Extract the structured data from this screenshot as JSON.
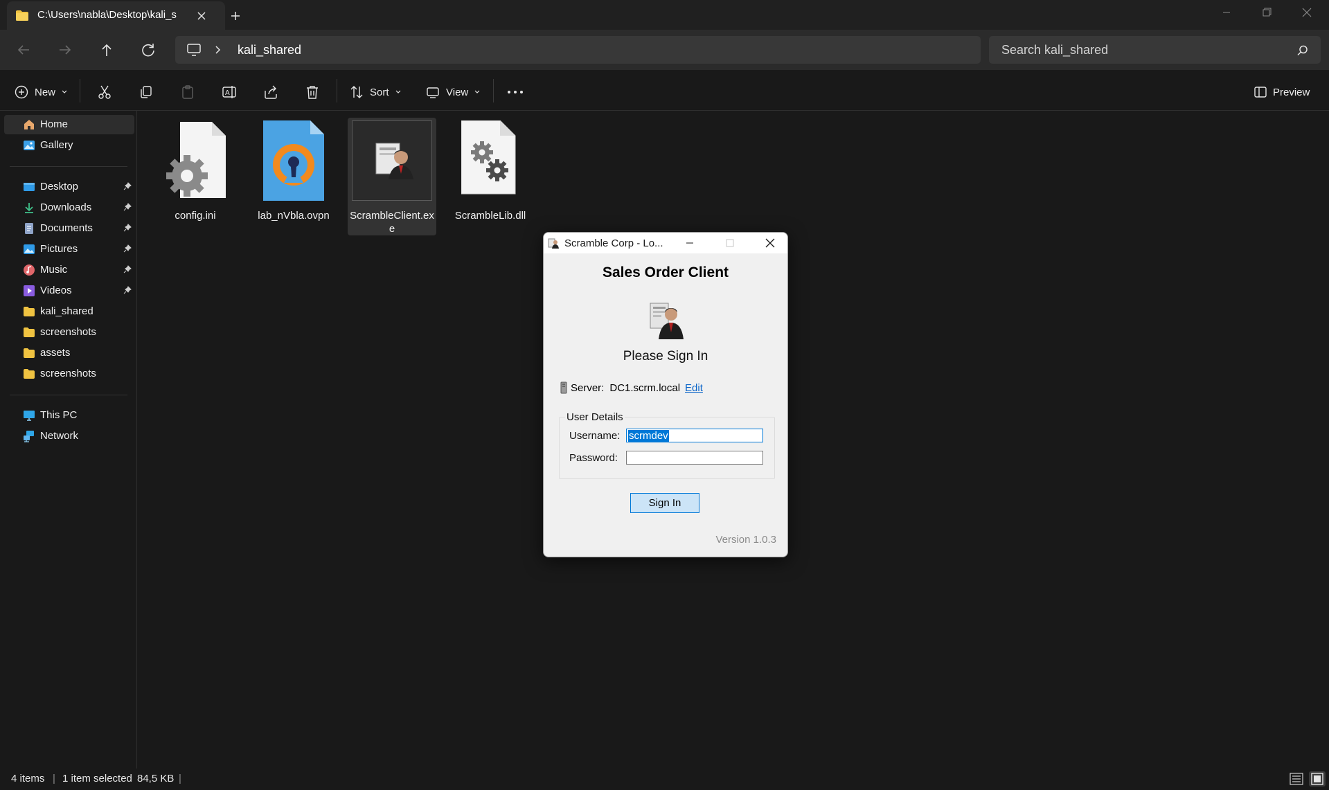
{
  "window": {
    "tab_title": "C:\\Users\\nabla\\Desktop\\kali_s",
    "breadcrumb": "kali_shared",
    "search_placeholder": "Search kali_shared"
  },
  "toolbar": {
    "new_label": "New",
    "sort_label": "Sort",
    "view_label": "View",
    "preview_label": "Preview"
  },
  "sidebar": {
    "top": [
      {
        "label": "Home",
        "icon": "home-icon",
        "selected": true
      },
      {
        "label": "Gallery",
        "icon": "gallery-icon"
      }
    ],
    "pinned": [
      {
        "label": "Desktop",
        "icon": "desktop-folder-icon",
        "pinned": true
      },
      {
        "label": "Downloads",
        "icon": "downloads-folder-icon",
        "pinned": true
      },
      {
        "label": "Documents",
        "icon": "documents-folder-icon",
        "pinned": true
      },
      {
        "label": "Pictures",
        "icon": "pictures-folder-icon",
        "pinned": true
      },
      {
        "label": "Music",
        "icon": "music-folder-icon",
        "pinned": true
      },
      {
        "label": "Videos",
        "icon": "videos-folder-icon",
        "pinned": true
      },
      {
        "label": "kali_shared",
        "icon": "folder-icon"
      },
      {
        "label": "screenshots",
        "icon": "folder-icon"
      },
      {
        "label": "assets",
        "icon": "folder-icon"
      },
      {
        "label": "screenshots",
        "icon": "folder-icon"
      }
    ],
    "bottom": [
      {
        "label": "This PC",
        "icon": "this-pc-icon"
      },
      {
        "label": "Network",
        "icon": "network-icon"
      }
    ]
  },
  "files": [
    {
      "name": "config.ini",
      "icon": "settings-file-icon"
    },
    {
      "name": "lab_nVbla.ovpn",
      "icon": "openvpn-file-icon"
    },
    {
      "name": "ScrambleClient.exe",
      "icon": "scramble-app-icon",
      "selected": true
    },
    {
      "name": "ScrambleLib.dll",
      "icon": "dll-file-icon"
    }
  ],
  "status": {
    "count": "4 items",
    "selection": "1 item selected",
    "size": "84,5 KB"
  },
  "dialog": {
    "title": "Scramble Corp - Lo...",
    "heading": "Sales Order Client",
    "subheading": "Please Sign In",
    "server_label": "Server:",
    "server_value": "DC1.scrm.local",
    "edit_link": "Edit",
    "group_label": "User Details",
    "username_label": "Username:",
    "username_value": "scrmdev",
    "password_label": "Password:",
    "password_value": "",
    "signin_label": "Sign In",
    "version": "Version 1.0.3"
  },
  "colors": {
    "dark_bg": "#191919",
    "accent": "#0078d7",
    "folder": "#f0c341"
  }
}
